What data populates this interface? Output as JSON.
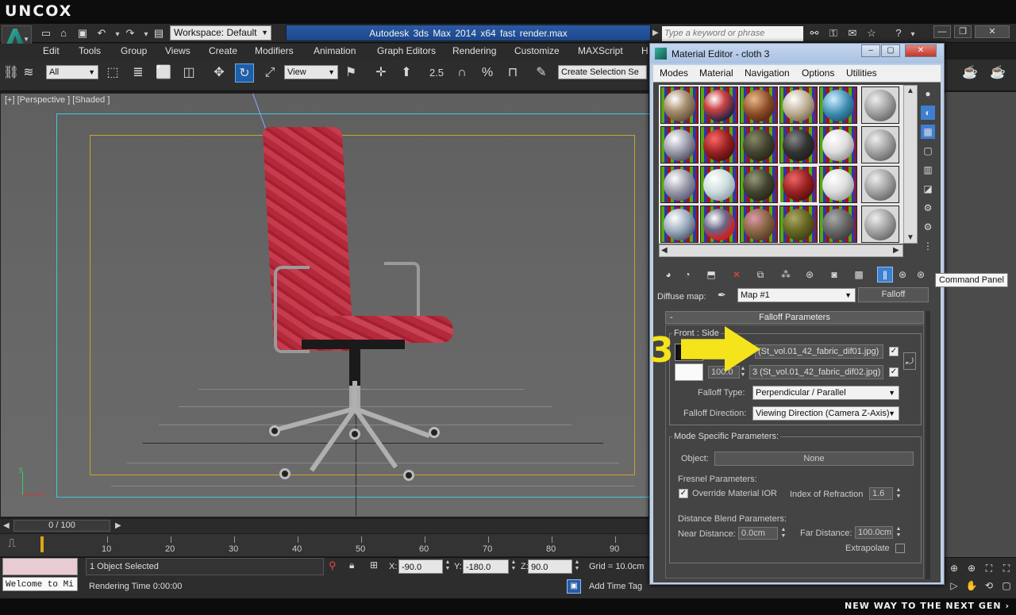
{
  "branding": {
    "logo": "uncox",
    "tagline": "NEW WAY TO THE NEXT GEN ›"
  },
  "titlebar": {
    "workspace": "Workspace: Default",
    "app_title": "Autodesk 3ds Max  2014 x64      fast render.max",
    "search_placeholder": "Type a keyword or phrase"
  },
  "menubar": {
    "items": [
      "Edit",
      "Tools",
      "Group",
      "Views",
      "Create",
      "Modifiers",
      "Animation",
      "Graph Editors",
      "Rendering",
      "Customize",
      "MAXScript",
      "H"
    ]
  },
  "toolbar": {
    "filter": "All",
    "ref_coord": "View",
    "snap_value": "2.5",
    "selection_set": "Create Selection Se"
  },
  "viewport": {
    "label": "[+] [Perspective ] [Shaded ]",
    "axis_x": "x",
    "axis_y": "y"
  },
  "timeline": {
    "frame_display": "0 / 100",
    "ruler_numbers": [
      "10",
      "20",
      "30",
      "40",
      "50",
      "60",
      "70",
      "80",
      "90"
    ]
  },
  "statusbar": {
    "selection": "1 Object Selected",
    "render_time": "Rendering Time  0:00:00",
    "welcome": "Welcome to Mi",
    "x_label": "X:",
    "x_value": "-90.0",
    "y_label": "Y:",
    "y_value": "-180.0",
    "z_label": "Z:",
    "z_value": "90.0",
    "grid": "Grid = 10.0cm",
    "add_time_tag": "Add Time Tag"
  },
  "material_editor": {
    "title": "Material Editor - cloth 3",
    "menu": [
      "Modes",
      "Material",
      "Navigation",
      "Options",
      "Utilities"
    ],
    "tooltip": "Command Panel",
    "diffuse_label": "Diffuse map:",
    "map_name": "Map #1",
    "map_type": "Falloff",
    "rollout_title": "Falloff Parameters",
    "rollout_toggle": "-",
    "front_side_label": "Front : Side",
    "map1": "(St_vol.01_42_fabric_dif01.jpg)",
    "map2": "3 (St_vol.01_42_fabric_dif02.jpg)",
    "amount2": "100.0",
    "falloff_type_label": "Falloff Type:",
    "falloff_type": "Perpendicular / Parallel",
    "falloff_dir_label": "Falloff Direction:",
    "falloff_dir": "Viewing Direction (Camera Z-Axis)",
    "mode_specific": "Mode Specific Parameters:",
    "object_label": "Object:",
    "object_value": "None",
    "fresnel": "Fresnel Parameters:",
    "override_ior": "Override Material IOR",
    "ior_label": "Index of Refraction",
    "ior_value": "1.6",
    "distance_blend": "Distance Blend Parameters:",
    "near_label": "Near Distance:",
    "near_value": "0.0cm",
    "far_label": "Far Distance:",
    "far_value": "100.0cm",
    "extrapolate": "Extrapolate"
  },
  "annotation": {
    "step_number": "3"
  },
  "colors": {
    "accent": "#1d5fa8",
    "annotation": "#f5e31c",
    "chair": "#b52a3b"
  }
}
